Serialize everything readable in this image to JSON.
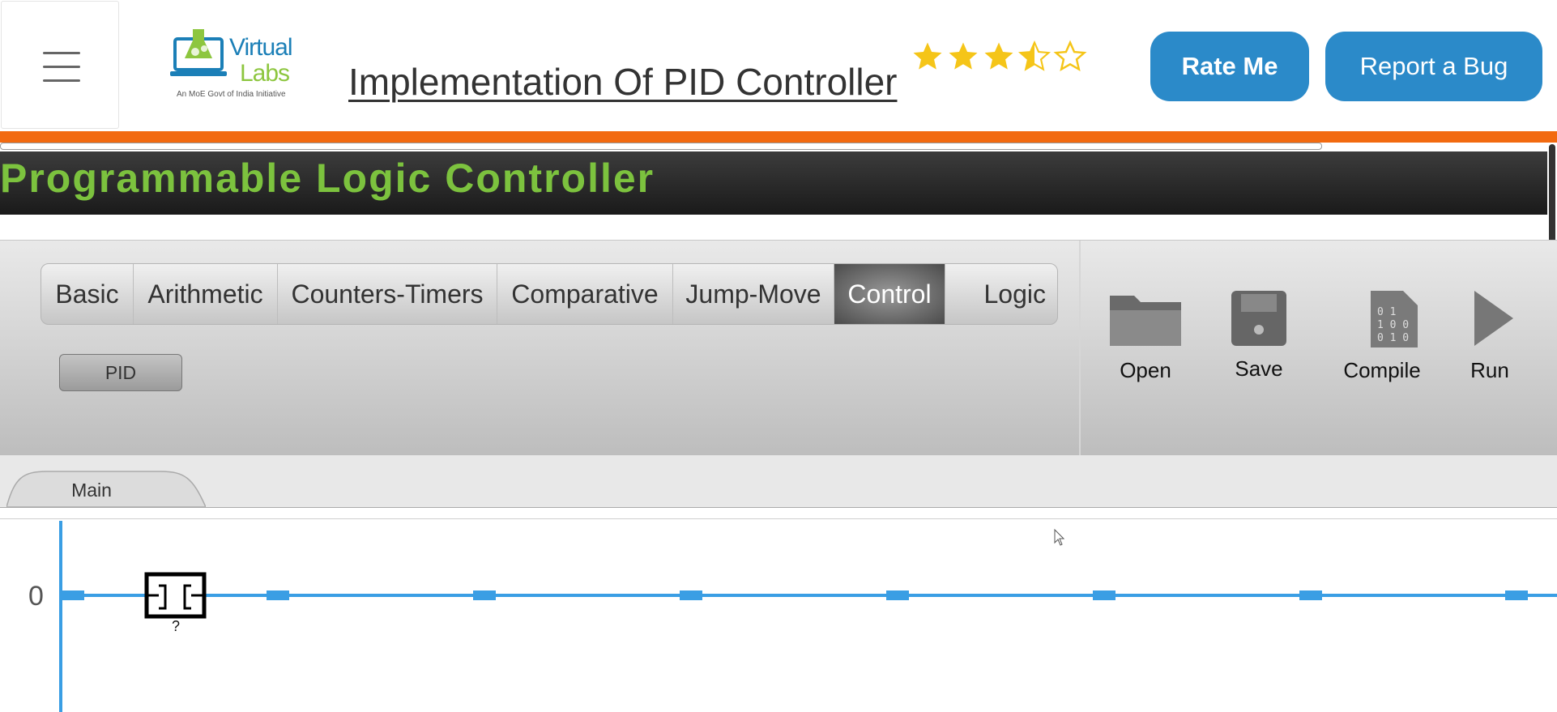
{
  "header": {
    "logo": {
      "name": "Virtual",
      "name2": "Labs",
      "tagline": "An MoE Govt of India Initiative"
    },
    "title": "Implementation Of PID Controller",
    "rating": {
      "value": 3.5,
      "max": 5
    },
    "rate_button": "Rate Me",
    "bug_button": "Report a Bug"
  },
  "plc": {
    "title": "Programmable Logic Controller",
    "tabs": [
      "Basic",
      "Arithmetic",
      "Counters-Timers",
      "Comparative",
      "Jump-Move",
      "Control",
      "Logic"
    ],
    "active_tab": "Control",
    "instructions": [
      "PID"
    ],
    "tools": [
      "Open",
      "Save",
      "Compile",
      "Run"
    ],
    "sheet_tabs": [
      "Main"
    ],
    "rungs": [
      {
        "number": "0",
        "element_label": "?"
      }
    ]
  },
  "colors": {
    "accent_blue": "#2b8ac9",
    "orange": "#f26a10",
    "plc_green": "#7cc23e",
    "rung_blue": "#3a9ee4",
    "star_gold": "#f5c518"
  }
}
